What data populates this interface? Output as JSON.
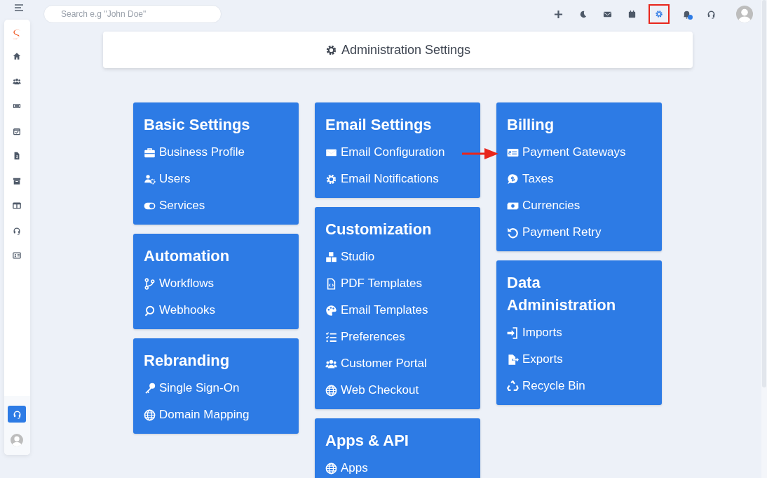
{
  "search": {
    "placeholder": "Search e.g \"John Doe\""
  },
  "toolbar": [
    {
      "highlighted": false
    },
    {
      "highlighted": false
    },
    {
      "highlighted": false
    },
    {
      "highlighted": false
    },
    {
      "highlighted": true
    },
    {
      "highlighted": false
    },
    {
      "highlighted": false
    }
  ],
  "sidebar": {
    "items": [
      {
        "selected": false
      },
      {
        "selected": false
      },
      {
        "selected": false
      },
      {
        "selected": false
      },
      {
        "selected": false
      },
      {
        "selected": false
      },
      {
        "selected": false
      },
      {
        "selected": false
      },
      {
        "selected": false
      }
    ],
    "support_button": {
      "selected": true
    }
  },
  "header": {
    "title": "Administration Settings"
  },
  "columns": [
    {
      "cards": [
        {
          "title": "Basic Settings",
          "items": [
            "Business Profile",
            "Users",
            "Services"
          ]
        },
        {
          "title": "Automation",
          "items": [
            "Workflows",
            "Webhooks"
          ]
        },
        {
          "title": "Rebranding",
          "items": [
            "Single Sign-On",
            "Domain Mapping"
          ]
        }
      ]
    },
    {
      "cards": [
        {
          "title": "Email Settings",
          "items": [
            "Email Configuration",
            "Email Notifications"
          ]
        },
        {
          "title": "Customization",
          "items": [
            "Studio",
            "PDF Templates",
            "Email Templates",
            "Preferences",
            "Customer Portal",
            "Web Checkout"
          ]
        },
        {
          "title": "Apps & API",
          "items": [
            "Apps"
          ]
        }
      ]
    },
    {
      "cards": [
        {
          "title": "Billing",
          "items": [
            "Payment Gateways",
            "Taxes",
            "Currencies",
            "Payment Retry"
          ]
        },
        {
          "title": "Data Administration",
          "items": [
            "Imports",
            "Exports",
            "Recycle Bin"
          ]
        }
      ]
    }
  ]
}
